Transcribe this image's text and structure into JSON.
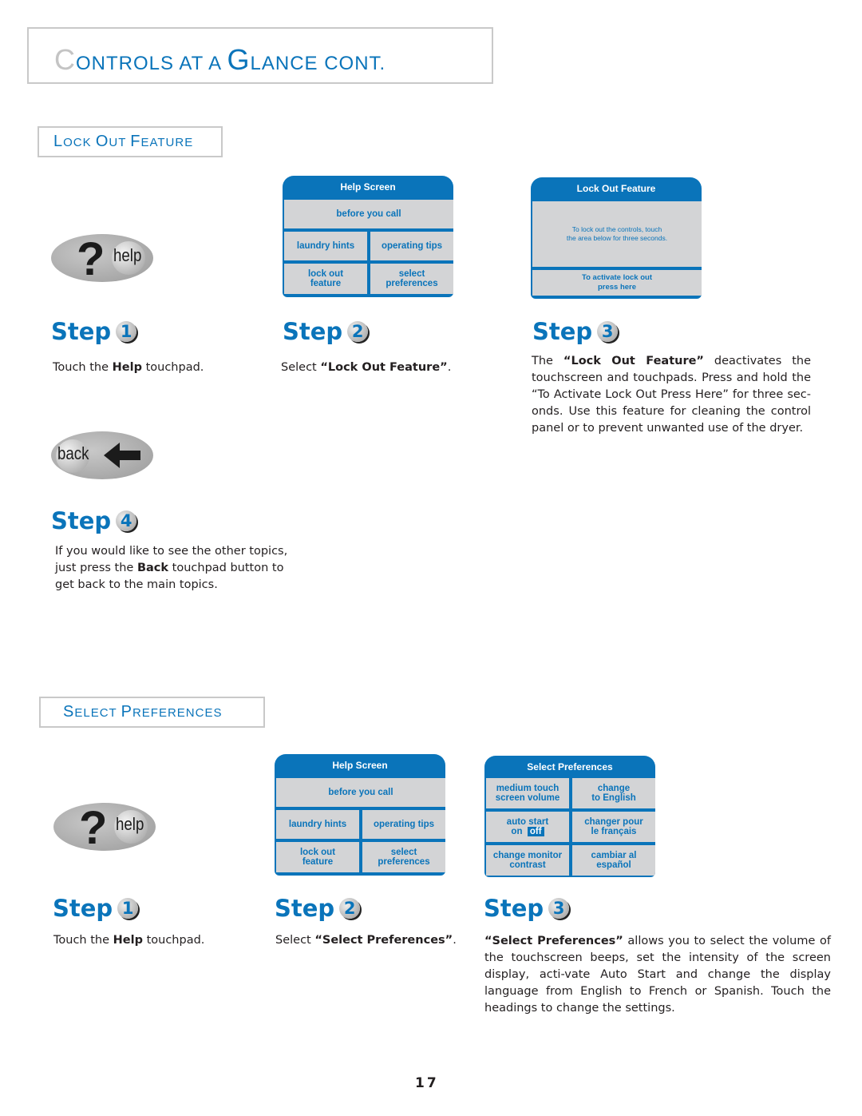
{
  "header": {
    "title_first_letter": "C",
    "title_rest1": "ONTROLS AT A ",
    "title_G": "G",
    "title_rest2": "LANCE CONT."
  },
  "sections": {
    "lock_out": {
      "heading": [
        {
          "big": "L",
          "small": "OCK "
        },
        {
          "big": "O",
          "small": "UT "
        },
        {
          "big": "F",
          "small": "EATURE"
        }
      ],
      "help_pad": {
        "label": "help",
        "icon": "question-mark-icon"
      },
      "back_pad": {
        "label": "back",
        "icon": "left-arrow-icon"
      },
      "help_screen": {
        "title": "Help Screen",
        "before_you_call": "before you call",
        "laundry_hints": "laundry hints",
        "operating_tips": "operating tips",
        "lock_out_1": "lock out",
        "lock_out_2": "feature",
        "select_1": "select",
        "select_2": "preferences"
      },
      "lock_screen": {
        "title": "Lock Out Feature",
        "msg_1": "To lock out the controls, touch",
        "msg_2": "the area below for three seconds.",
        "btn_1": "To activate lock out",
        "btn_2": "press here"
      },
      "steps": [
        {
          "label": "Step",
          "num": "1",
          "pre": "Touch the ",
          "bold": "Help",
          "post": " touchpad."
        },
        {
          "label": "Step",
          "num": "2",
          "pre": "Select ",
          "bold": "“Lock Out Feature”",
          "post": "."
        },
        {
          "label": "Step",
          "num": "3",
          "pre": "The ",
          "bold": "“Lock Out Feature”",
          "post": " deactivates the touchscreen and touchpads.  Press and hold the “To Activate Lock Out Press Here” for three sec-onds.  Use this feature for cleaning the control panel or to prevent unwanted use of the dryer."
        },
        {
          "label": "Step",
          "num": "4",
          "pre": "If you would like to see the other topics, just press the ",
          "bold": "Back",
          "post": " touchpad button to get back to the main topics."
        }
      ]
    },
    "select_prefs": {
      "heading": [
        {
          "big": "S",
          "small": "ELECT "
        },
        {
          "big": "P",
          "small": "REFERENCES"
        }
      ],
      "help_pad": {
        "label": "help",
        "icon": "question-mark-icon"
      },
      "help_screen": {
        "title": "Help Screen",
        "before_you_call": "before you call",
        "laundry_hints": "laundry hints",
        "operating_tips": "operating tips",
        "lock_out_1": "lock out",
        "lock_out_2": "feature",
        "select_1": "select",
        "select_2": "preferences"
      },
      "prefs_screen": {
        "title": "Select Preferences",
        "volume_1": "medium touch",
        "volume_2": "screen volume",
        "english_1": "change",
        "english_2": "to English",
        "auto_1": "auto start",
        "auto_on": "on",
        "auto_off": "off",
        "french_1": "changer pour",
        "french_2": "le français",
        "contrast_1": "change monitor",
        "contrast_2": "contrast",
        "spanish_1": "cambiar al",
        "spanish_2": "español"
      },
      "steps": [
        {
          "label": "Step",
          "num": "1",
          "pre": "Touch the ",
          "bold": "Help",
          "post": " touchpad."
        },
        {
          "label": "Step",
          "num": "2",
          "pre": "Select ",
          "bold": "“Select Preferences”",
          "post": "."
        },
        {
          "label": "Step",
          "num": "3",
          "pre": "",
          "bold": "“Select Preferences”",
          "post": " allows you to select the volume of the touchscreen beeps, set the intensity of the screen display, acti-vate Auto Start and change the display language from English to French or Spanish. Touch the headings to change the settings."
        }
      ]
    }
  },
  "footer": {
    "page_number": "17"
  },
  "colors": {
    "brand_blue": "#0a74ba",
    "screen_gray": "#d3d4d6",
    "border_gray": "#c9c9c9"
  }
}
